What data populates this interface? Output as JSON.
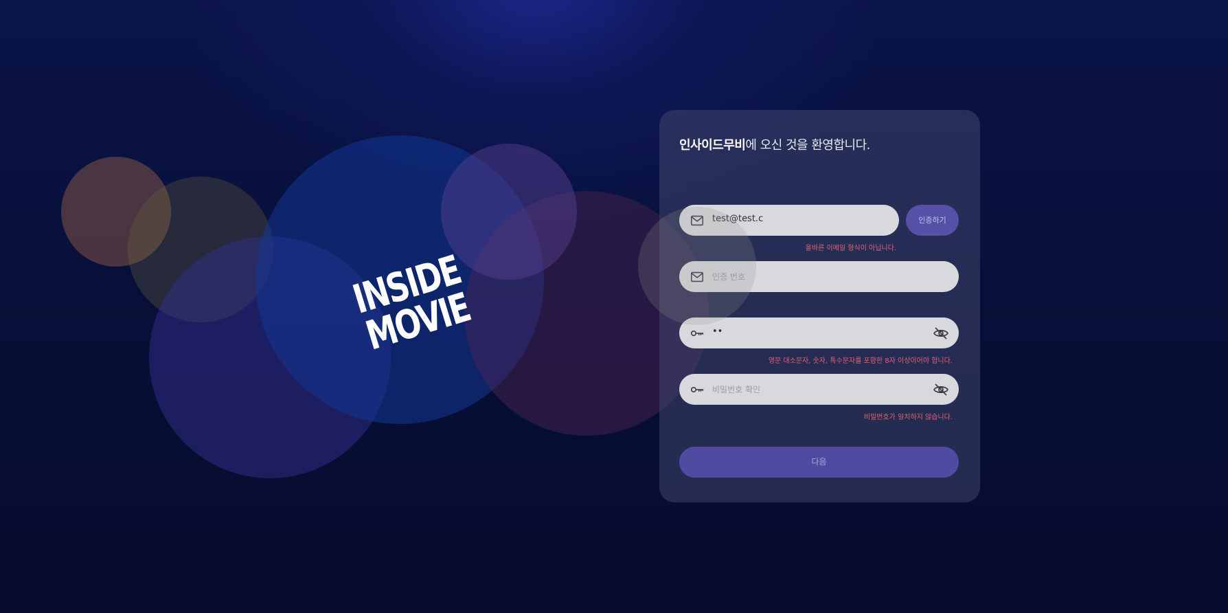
{
  "brand": {
    "logo_line1": "INSIDE",
    "logo_line2": "MOVIE"
  },
  "card": {
    "welcome_brand": "인사이드무비",
    "welcome_rest": "에 오신 것을 환영합니다.",
    "email": {
      "value": "test@test.c",
      "icon": "mail-icon",
      "error": "올바른 이메일 형식이 아닙니다."
    },
    "verify_button": "인증하기",
    "code": {
      "placeholder": "인증 번호",
      "icon": "mail-icon"
    },
    "password": {
      "value": "••",
      "icon": "key-icon",
      "error": "영문 대소문자, 숫자, 특수문자를 포함한 8자 이상이어야 합니다."
    },
    "password_confirm": {
      "placeholder": "비밀번호 확인",
      "icon": "key-icon",
      "error": "비밀번호가 일치하지 않습니다."
    },
    "next_button": "다음"
  },
  "colors": {
    "accent": "#5650a6",
    "error": "#e86070",
    "field_bg": "#d8d9dd"
  }
}
